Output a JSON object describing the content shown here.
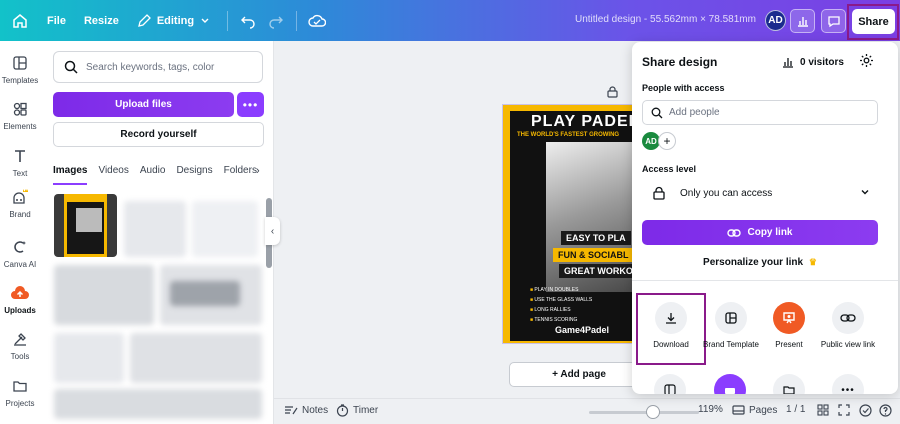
{
  "topbar": {
    "file": "File",
    "resize": "Resize",
    "editing": "Editing",
    "doc_title": "Untitled design - 55.562mm × 78.581mm",
    "avatar": "AD",
    "share": "Share"
  },
  "rail": {
    "items": [
      {
        "label": "Templates",
        "icon": "templates-icon"
      },
      {
        "label": "Elements",
        "icon": "elements-icon"
      },
      {
        "label": "Text",
        "icon": "text-icon"
      },
      {
        "label": "Brand",
        "icon": "brand-icon"
      },
      {
        "label": "Canva AI",
        "icon": "canva-ai-icon"
      },
      {
        "label": "Uploads",
        "icon": "uploads-icon"
      },
      {
        "label": "Tools",
        "icon": "tools-icon"
      },
      {
        "label": "Projects",
        "icon": "projects-icon"
      }
    ]
  },
  "panel": {
    "search_placeholder": "Search keywords, tags, color",
    "upload": "Upload files",
    "record": "Record yourself",
    "tabs": [
      "Images",
      "Videos",
      "Audio",
      "Designs",
      "Folders"
    ]
  },
  "design": {
    "title": "PLAY PADEL",
    "subtitle": "THE WORLD'S FASTEST GROWING",
    "pill1": "EASY TO PLA",
    "pill2": "FUN & SOCIABL",
    "pill3": "GREAT WORKOU",
    "bullets": [
      "PLAY IN DOUBLES",
      "USE THE GLASS WALLS",
      "LONG RALLIES",
      "TENNIS SCORING"
    ],
    "brand": "Game4Padel"
  },
  "canvas": {
    "add_page": "+ Add page"
  },
  "bottombar": {
    "notes": "Notes",
    "timer": "Timer",
    "zoom": "119%",
    "pages": "Pages",
    "page_count": "1 / 1"
  },
  "share_panel": {
    "title": "Share design",
    "visitors": "0 visitors",
    "people_label": "People with access",
    "add_people": "Add people",
    "avatar": "AD",
    "access_label": "Access level",
    "access_value": "Only you can access",
    "copy_link": "Copy link",
    "personalize": "Personalize your link",
    "options": [
      {
        "label": "Download",
        "icon": "download-icon"
      },
      {
        "label": "Brand Template",
        "icon": "brand-template-icon"
      },
      {
        "label": "Present",
        "icon": "present-icon"
      },
      {
        "label": "Public view link",
        "icon": "link-icon"
      }
    ]
  },
  "colors": {
    "accent": "#8b3dff",
    "brand_yellow": "#f6b800",
    "present_orange": "#f05a24",
    "highlight": "#8a1a8a"
  }
}
